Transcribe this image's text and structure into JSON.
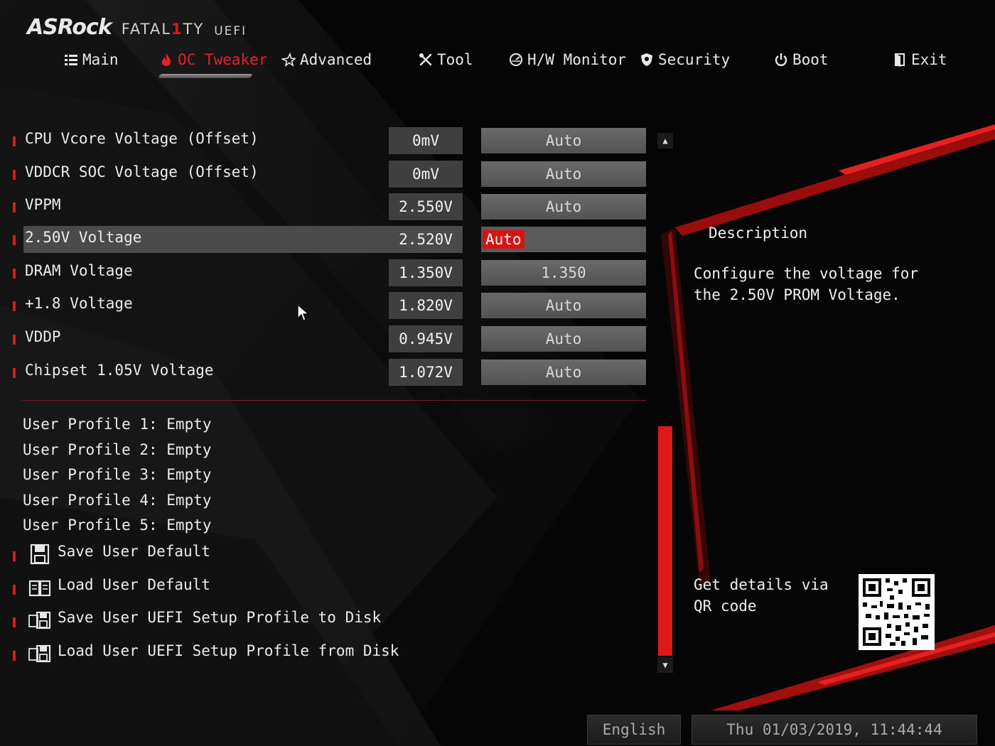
{
  "header": {
    "brand": "ASRock",
    "product_prefix": "FATAL",
    "product_mark": "1",
    "product_suffix": "TY",
    "suffix": "UEFI"
  },
  "tabs": [
    {
      "label": "Main",
      "icon": "list-icon",
      "active": false
    },
    {
      "label": "OC Tweaker",
      "icon": "flame-icon",
      "active": true
    },
    {
      "label": "Advanced",
      "icon": "star-icon",
      "active": false
    },
    {
      "label": "Tool",
      "icon": "tools-icon",
      "active": false
    },
    {
      "label": "H/W Monitor",
      "icon": "monitor-icon",
      "active": false
    },
    {
      "label": "Security",
      "icon": "shield-icon",
      "active": false
    },
    {
      "label": "Boot",
      "icon": "power-icon",
      "active": false
    },
    {
      "label": "Exit",
      "icon": "exit-door-icon",
      "active": false
    }
  ],
  "voltage_settings": [
    {
      "label": "CPU Vcore Voltage (Offset)",
      "reading": "0mV",
      "value": "Auto"
    },
    {
      "label": "VDDCR SOC Voltage (Offset)",
      "reading": "0mV",
      "value": "Auto"
    },
    {
      "label": "VPPM",
      "reading": "2.550V",
      "value": "Auto"
    },
    {
      "label": "2.50V Voltage",
      "reading": "2.520V",
      "value": "Auto",
      "selected": true
    },
    {
      "label": "DRAM Voltage",
      "reading": "1.350V",
      "value": "1.350"
    },
    {
      "label": "+1.8 Voltage",
      "reading": "1.820V",
      "value": "Auto"
    },
    {
      "label": "VDDP",
      "reading": "0.945V",
      "value": "Auto"
    },
    {
      "label": "Chipset 1.05V Voltage",
      "reading": "1.072V",
      "value": "Auto"
    }
  ],
  "user_profiles": [
    "User Profile 1: Empty",
    "User Profile 2: Empty",
    "User Profile 3: Empty",
    "User Profile 4: Empty",
    "User Profile 5: Empty"
  ],
  "profile_actions": [
    {
      "label": "Save User Default",
      "icon": "floppy-disk-icon"
    },
    {
      "label": "Load User Default",
      "icon": "open-book-icon"
    },
    {
      "label": "Save User UEFI Setup Profile to Disk",
      "icon": "disk-save-icon"
    },
    {
      "label": "Load User UEFI Setup Profile from Disk",
      "icon": "disk-load-icon"
    }
  ],
  "description": {
    "title": "Description",
    "text": "Configure the voltage for the 2.50V PROM Voltage.",
    "qr_text": "Get details via QR code",
    "qr_icon": "qr-code-icon"
  },
  "footer": {
    "language": "English",
    "datetime": "Thu 01/03/2019, 11:44:44"
  },
  "colors": {
    "accent": "#d61c1c",
    "background": "#050505",
    "field": "#5e5e5e",
    "reading_box": "#3f3f3f"
  }
}
